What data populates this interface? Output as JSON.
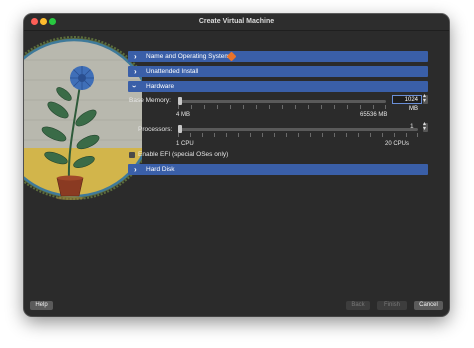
{
  "window": {
    "title": "Create Virtual Machine"
  },
  "sections": {
    "name_os": {
      "label": "Name and Operating System"
    },
    "unattended": {
      "label": "Unattended Install"
    },
    "hardware": {
      "label": "Hardware"
    },
    "hard_disk": {
      "label": "Hard Disk"
    }
  },
  "hardware": {
    "base_memory": {
      "label": "Base Memory:",
      "value": "1024 MB",
      "min": "4 MB",
      "max": "65536 MB"
    },
    "processors": {
      "label": "Processors:",
      "value": "1",
      "min": "1 CPU",
      "max": "20 CPUs"
    },
    "efi": {
      "label": "Enable EFI (special OSes only)",
      "checked": false
    }
  },
  "footer": {
    "help": "Help",
    "back": "Back",
    "finish": "Finish",
    "cancel": "Cancel"
  },
  "colors": {
    "accent": "#3a5fa8",
    "warning": "#e8732b"
  }
}
